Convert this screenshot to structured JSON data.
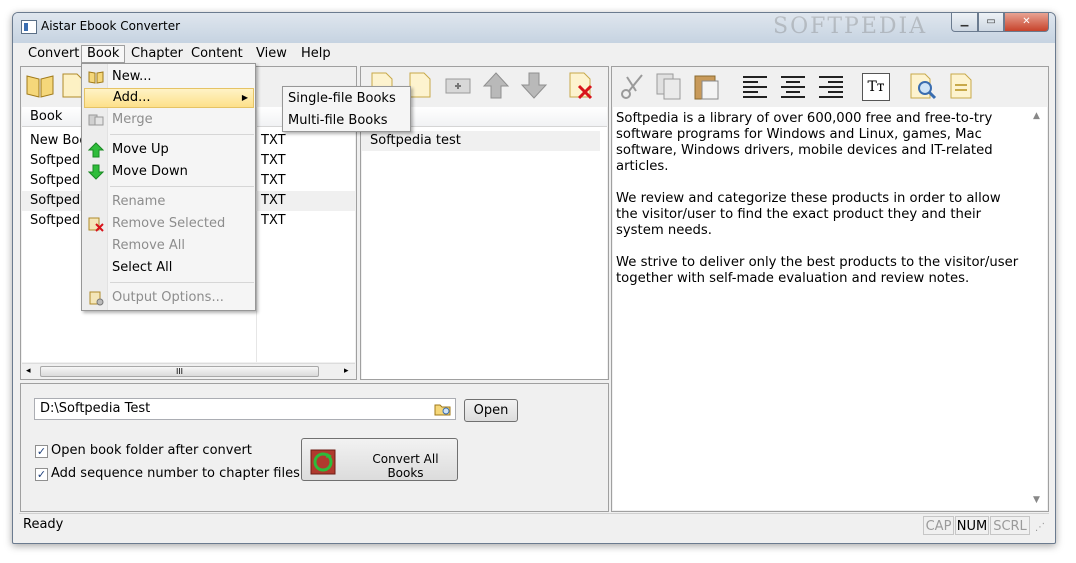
{
  "window": {
    "title": "Aistar Ebook Converter",
    "watermark": "SOFTPEDIA"
  },
  "menubar": [
    "Convert",
    "Book",
    "Chapter",
    "Content",
    "View",
    "Help"
  ],
  "book_list": {
    "header": "Book",
    "rows": [
      {
        "name": "New Boo",
        "type": "TXT"
      },
      {
        "name": "Softpedia",
        "type": "TXT"
      },
      {
        "name": "Softpedia",
        "type": "TXT"
      },
      {
        "name": "Softpedia",
        "type": "TXT"
      },
      {
        "name": "Softpedia",
        "type": "TXT"
      }
    ],
    "scroll_grip": "III"
  },
  "chapter_list": {
    "rows": [
      "Softpedia test"
    ]
  },
  "book_menu": {
    "items": [
      {
        "label": "New...",
        "enabled": true,
        "icon": "open-book-icon"
      },
      {
        "label": "Add...",
        "enabled": true,
        "icon": "",
        "hot": true,
        "has_submenu": true
      },
      {
        "label": "Merge",
        "enabled": false,
        "icon": "merge-icon"
      },
      {
        "label": "Move Up",
        "enabled": true,
        "icon": "arrow-up-icon"
      },
      {
        "label": "Move Down",
        "enabled": true,
        "icon": "arrow-down-icon"
      },
      {
        "label": "Rename",
        "enabled": false,
        "icon": ""
      },
      {
        "label": "Remove Selected",
        "enabled": false,
        "icon": "remove-selected-icon"
      },
      {
        "label": "Remove All",
        "enabled": false,
        "icon": ""
      },
      {
        "label": "Select All",
        "enabled": true,
        "icon": ""
      },
      {
        "label": "Output Options...",
        "enabled": false,
        "icon": "output-options-icon"
      }
    ],
    "submenu_arrow": "▶"
  },
  "add_submenu": [
    "Single-file Books",
    "Multi-file Books"
  ],
  "output": {
    "folder": "D:\\Softpedia Test",
    "open_button": "Open",
    "open_folder_label": "Open book folder after convert",
    "open_folder_checked": true,
    "sequence_label": "Add sequence number to chapter files",
    "sequence_checked": true,
    "convert_button": "Convert All Books"
  },
  "preview": {
    "text": "Softpedia is a library of over 600,000 free and free-to-try\nsoftware programs for Windows and Linux, games, Mac\nsoftware, Windows drivers, mobile devices and IT-related\narticles.\n\nWe review and categorize these products in order to allow\nthe visitor/user to find the exact product they and their\nsystem needs.\n\nWe strive to deliver only the best products to the visitor/user\ntogether with self-made evaluation and review notes."
  },
  "statusbar": {
    "text": "Ready",
    "cap": "CAP",
    "num": "NUM",
    "scrl": "SCRL"
  },
  "colors": {
    "accent": "#3a6db0",
    "menu_highlight": "#fde08a",
    "disabled_text": "#8d8d8d"
  }
}
